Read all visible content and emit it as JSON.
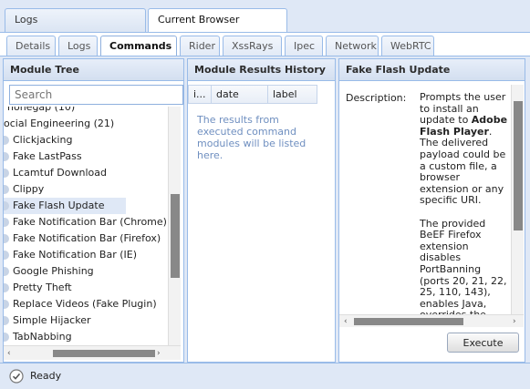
{
  "top_tabs": [
    {
      "label": "Logs",
      "active": false
    },
    {
      "label": "Current Browser",
      "active": true
    }
  ],
  "sub_tabs": [
    {
      "label": "Details",
      "active": false
    },
    {
      "label": "Logs",
      "active": false
    },
    {
      "label": "Commands",
      "active": true
    },
    {
      "label": "Rider",
      "active": false
    },
    {
      "label": "XssRays",
      "active": false
    },
    {
      "label": "Ipec",
      "active": false
    },
    {
      "label": "Network",
      "active": false
    },
    {
      "label": "WebRTC",
      "active": false
    }
  ],
  "module_tree": {
    "title": "Module Tree",
    "search_placeholder": "Search",
    "items": [
      {
        "label": "honegap (10)",
        "leaf": false
      },
      {
        "label": "ocial Engineering (21)",
        "leaf": false
      },
      {
        "label": "Clickjacking",
        "leaf": true
      },
      {
        "label": "Fake LastPass",
        "leaf": true
      },
      {
        "label": "Lcamtuf Download",
        "leaf": true
      },
      {
        "label": "Clippy",
        "leaf": true
      },
      {
        "label": "Fake Flash Update",
        "leaf": true,
        "selected": true
      },
      {
        "label": "Fake Notification Bar (Chrome)",
        "leaf": true
      },
      {
        "label": "Fake Notification Bar (Firefox)",
        "leaf": true
      },
      {
        "label": "Fake Notification Bar (IE)",
        "leaf": true
      },
      {
        "label": "Google Phishing",
        "leaf": true
      },
      {
        "label": "Pretty Theft",
        "leaf": true
      },
      {
        "label": "Replace Videos (Fake Plugin)",
        "leaf": true
      },
      {
        "label": "Simple Hijacker",
        "leaf": true
      },
      {
        "label": "TabNabbing",
        "leaf": true
      }
    ]
  },
  "results_history": {
    "title": "Module Results History",
    "columns": [
      "i...",
      "date",
      "label"
    ],
    "empty_message": "The results from executed command modules will be listed here."
  },
  "module_detail": {
    "title": "Fake Flash Update",
    "description_label": "Description:",
    "desc_pre": "Prompts the user to install an update to ",
    "desc_bold": "Adobe Flash Player",
    "desc_after": ".",
    "desc_p2": "The delivered payload could be a custom file, a browser extension or any specific URI.",
    "desc_p3": "The provided BeEF Firefox extension disables PortBanning (ports 20, 21, 22, 25, 110, 143), enables Java, overrides the User Agent",
    "execute_label": "Execute"
  },
  "status_bar": {
    "text": "Ready",
    "icon": "ready-icon"
  },
  "colors": {
    "background": "#dfe8f6",
    "border": "#99bbe8",
    "selected_row": "#dfe8f6",
    "empty_message": "#6f8fc0"
  }
}
